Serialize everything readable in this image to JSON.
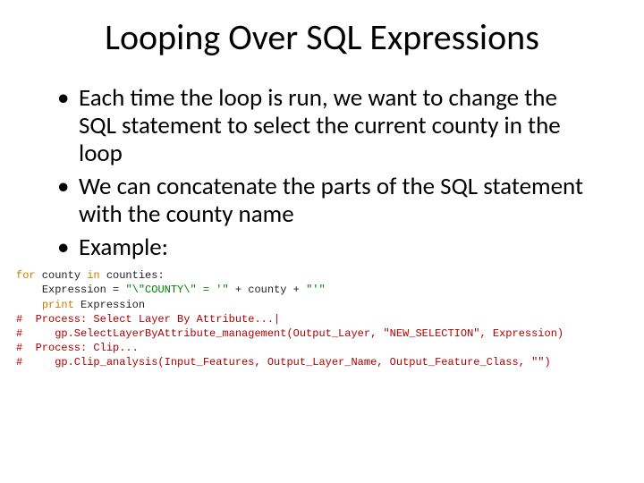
{
  "title": "Looping Over SQL Expressions",
  "bullets": [
    "Each time the loop is run, we want to change the SQL statement to select the current county in the loop",
    "We can concatenate the parts of the SQL statement with the county name",
    "Example:"
  ],
  "code": {
    "line1": {
      "kw_for": "for",
      "var_county": " county ",
      "kw_in": "in",
      "var_counties": " counties",
      "colon": ":"
    },
    "line2": {
      "indent": "    ",
      "lhs": "Expression ",
      "eq": "=",
      "sp": " ",
      "str1": "\"\\\"COUNTY\\\" = '\"",
      "plus1": " + ",
      "mid": "county",
      "plus2": " + ",
      "str2": "\"'\""
    },
    "line3": {
      "indent": "    ",
      "kw_print": "print",
      "arg": " Expression"
    },
    "line4": "#  Process: Select Layer By Attribute...|",
    "line5": "#     gp.SelectLayerByAttribute_management(Output_Layer, \"NEW_SELECTION\", Expression)",
    "line6": "#  Process: Clip...",
    "line7": "#     gp.Clip_analysis(Input_Features, Output_Layer_Name, Output_Feature_Class, \"\")"
  }
}
